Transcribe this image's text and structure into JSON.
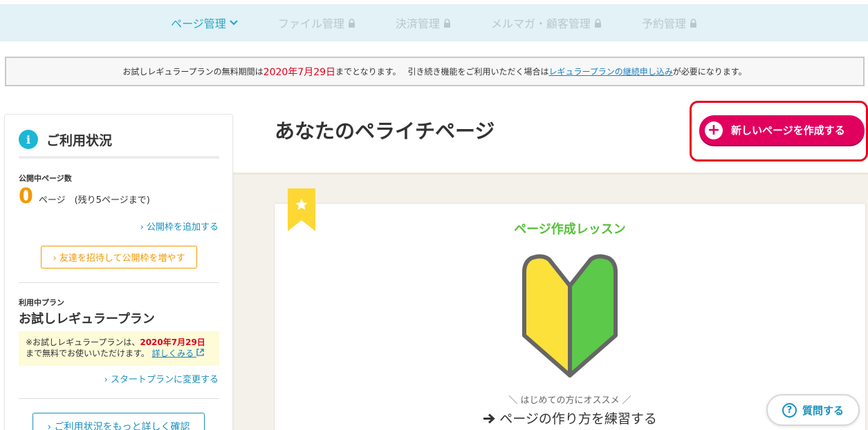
{
  "nav": {
    "items": [
      {
        "label": "ページ管理",
        "active": true,
        "icon": "chevron-down-icon"
      },
      {
        "label": "ファイル管理",
        "active": false,
        "icon": "lock-icon"
      },
      {
        "label": "決済管理",
        "active": false,
        "icon": "lock-icon"
      },
      {
        "label": "メルマガ・顧客管理",
        "active": false,
        "icon": "lock-icon"
      },
      {
        "label": "予約管理",
        "active": false,
        "icon": "lock-icon"
      }
    ]
  },
  "notice": {
    "text1": "お試しレギュラープランの無料期間は",
    "date": "2020年7月29日",
    "text2": "までとなります。",
    "text3": "引き続き機能をご利用いただく場合は",
    "link": "レギュラープランの継続申し込み",
    "text4": "が必要になります。"
  },
  "sidebar": {
    "title": "ご利用状況",
    "info_icon": "i",
    "pages_label": "公開中ページ数",
    "page_count": "0",
    "page_count_text": "ページ　(残り5ページまで)",
    "add_slot_link": "› 公開枠を追加する",
    "invite_button": "› 友達を招待して公開枠を増やす",
    "plan_label": "利用中プラン",
    "plan_name": "お試しレギュラープラン",
    "plan_note_1": "※お試しレギュラープランは、",
    "plan_note_date": "2020年7月29日",
    "plan_note_2": "まで無料でお使いいただけます。",
    "plan_note_link": "詳しくみる",
    "change_plan_link": "› スタートプランに変更する",
    "details_button": "› ご利用状況をもっと詳しく確認"
  },
  "main": {
    "page_title": "あなたのペライチページ",
    "new_page_button": "新しいページを作成する",
    "lesson_title": "ページ作成レッスン",
    "recommend_text": "＼ はじめての方にオススメ ／",
    "practice_link": "ページの作り方を練習する"
  },
  "help": {
    "label": "質問する"
  },
  "colors": {
    "accent": "#2aa5c8",
    "brand_pink": "#e2005f",
    "highlight_red": "#e8001c",
    "orange": "#f39800",
    "green": "#55c139",
    "yellow": "#fdd835"
  }
}
